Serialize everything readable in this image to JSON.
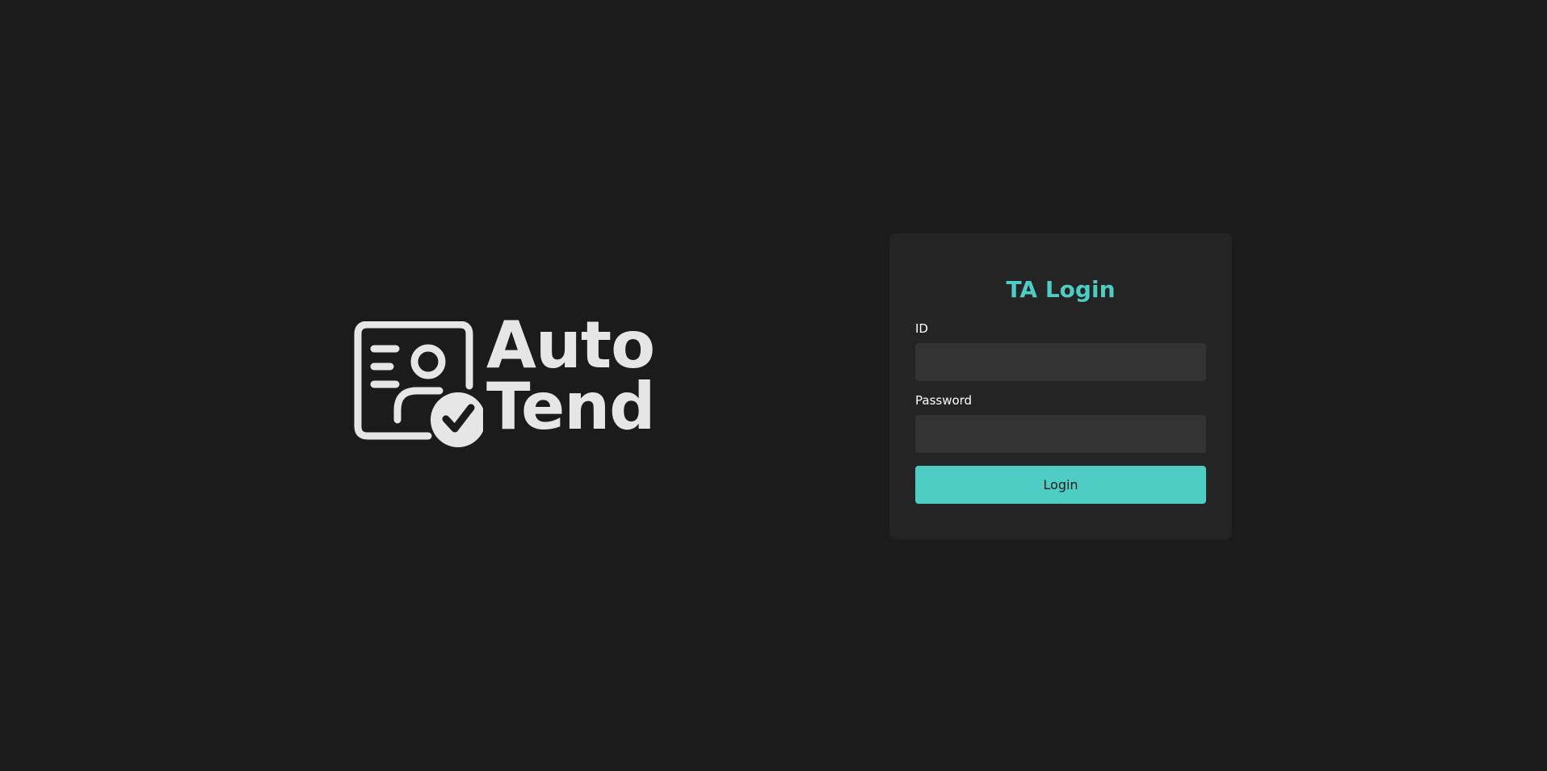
{
  "logo": {
    "line1": "Auto",
    "line2": "Tend",
    "icon": "attendance-check-icon",
    "color": "#e6e6e6"
  },
  "login_card": {
    "title": "TA Login",
    "id_label": "ID",
    "id_value": "",
    "password_label": "Password",
    "password_value": "",
    "submit_label": "Login"
  },
  "colors": {
    "background": "#1b1b1b",
    "card": "#242424",
    "input": "#333333",
    "accent": "#4ecdc4"
  }
}
